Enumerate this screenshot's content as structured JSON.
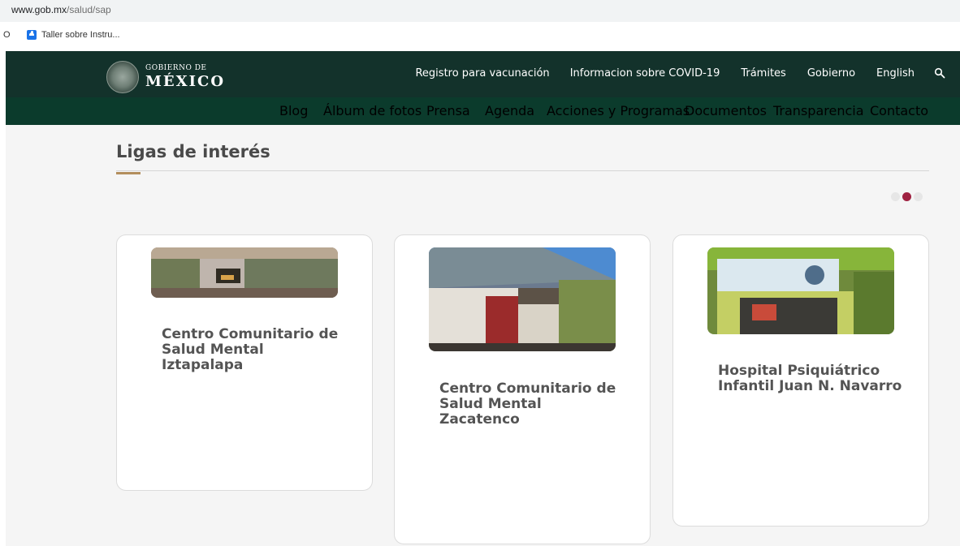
{
  "browser": {
    "url_host": "www.gob.mx",
    "url_path": "/salud/sap",
    "bookmark_prefix": "O",
    "bookmark_label": "Taller sobre Instru..."
  },
  "header": {
    "logo_line1": "GOBIERNO DE",
    "logo_line2": "MÉXICO",
    "nav_main": [
      "Registro para vacunación",
      "Informacion sobre COVID-19",
      "Trámites",
      "Gobierno",
      "English"
    ],
    "nav_sub": [
      "Blog",
      "Álbum de fotos",
      "Prensa",
      "Agenda",
      "Acciones y Programas",
      "Documentos",
      "Transparencia",
      "Contacto"
    ]
  },
  "section": {
    "title": "Ligas de interés"
  },
  "carousel": {
    "dot_count": 3,
    "active_dot": 1
  },
  "cards": [
    {
      "title": "Centro Comunitario de Salud Mental Iztapalapa"
    },
    {
      "title": "Centro Comunitario de Salud Mental Zacatenco"
    },
    {
      "title": "Hospital Psiquiátrico Infantil Juan N. Navarro"
    }
  ],
  "colors": {
    "header_dark": "#13322b",
    "header_sub": "#0b3b2c",
    "accent_gold": "#b38e5d",
    "dot_active": "#9f2241"
  }
}
